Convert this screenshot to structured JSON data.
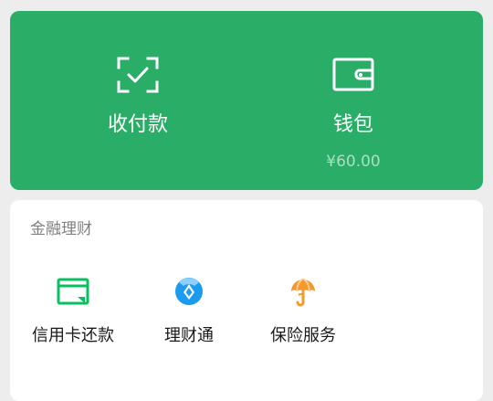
{
  "top_banner": {
    "pay": {
      "label": "收付款",
      "icon": "qr-scan-check-icon"
    },
    "wallet": {
      "label": "钱包",
      "balance": "¥60.00",
      "icon": "wallet-icon"
    }
  },
  "finance": {
    "title": "金融理财",
    "items": [
      {
        "label": "信用卡还款",
        "icon": "credit-card-icon",
        "color": "#07c160"
      },
      {
        "label": "理财通",
        "icon": "wealth-icon",
        "color": "#1a9bf0"
      },
      {
        "label": "保险服务",
        "icon": "insurance-umbrella-icon",
        "color": "#f49a2b"
      }
    ]
  },
  "colors": {
    "banner": "#2aae67",
    "background": "#ededed"
  }
}
